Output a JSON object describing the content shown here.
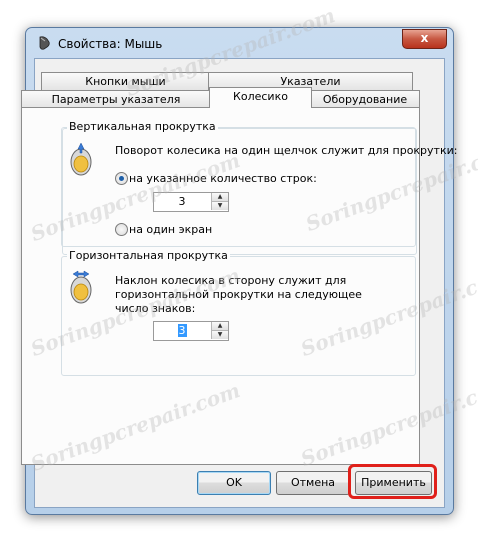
{
  "window": {
    "title": "Свойства: Мышь",
    "close_label": "x"
  },
  "tabs": {
    "row1": [
      {
        "label": "Кнопки мыши"
      },
      {
        "label": "Указатели"
      }
    ],
    "row2": [
      {
        "label": "Параметры указателя"
      },
      {
        "label": "Колесико",
        "active": true
      },
      {
        "label": "Оборудование"
      }
    ]
  },
  "vertical": {
    "title": "Вертикальная прокрутка",
    "description": "Поворот колесика на один щелчок служит для прокрутки:",
    "option_lines": "на указанное количество строк:",
    "lines_value": "3",
    "option_screen": "на один экран"
  },
  "horizontal": {
    "title": "Горизонтальная прокрутка",
    "description_line1": "Наклон колесика в сторону служит для",
    "description_line2": "горизонтальной прокрутки на следующее",
    "description_line3": "число знаков:",
    "chars_value": "3"
  },
  "buttons": {
    "ok": "OK",
    "cancel": "Отмена",
    "apply": "Применить"
  },
  "watermark": "Soringpcrepair.com",
  "colors": {
    "highlight": "#e0201a",
    "selection": "#3399ff",
    "close_button": "#c75842"
  }
}
